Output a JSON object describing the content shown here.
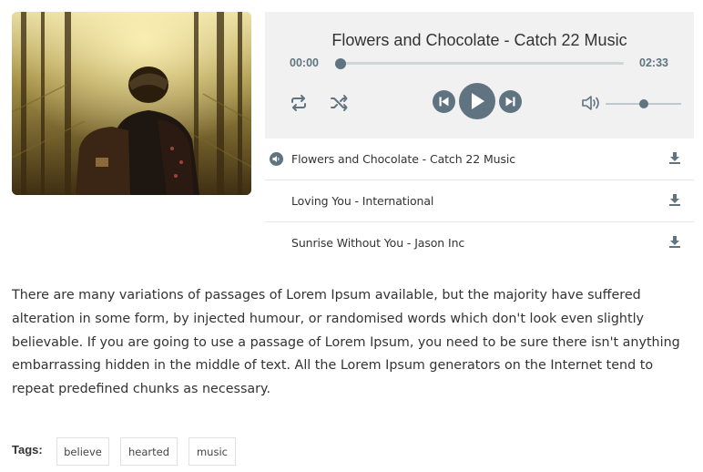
{
  "player": {
    "now_playing_title": "Flowers and Chocolate - Catch 22 Music",
    "current_time": "00:00",
    "duration": "02:33",
    "progress_fraction": 0.0,
    "volume_fraction": 0.5,
    "accent_color": "#5f7480"
  },
  "playlist": {
    "items": [
      {
        "label": "Flowers and Chocolate - Catch 22 Music",
        "playing": true
      },
      {
        "label": "Loving You - International",
        "playing": false
      },
      {
        "label": "Sunrise Without You - Jason Inc",
        "playing": false
      }
    ]
  },
  "description": "There are many variations of passages of Lorem Ipsum available, but the majority have suffered alteration in some form, by injected humour, or randomised words which don't look even slightly believable. If you are going to use a passage of Lorem Ipsum, you need to be sure there isn't anything embarrassing hidden in the middle of text. All the Lorem Ipsum generators on the Internet tend to repeat predefined chunks as necessary.",
  "tags": {
    "label": "Tags:",
    "items": [
      "believe",
      "hearted",
      "music"
    ]
  },
  "icons": {
    "repeat": "repeat-icon",
    "shuffle": "shuffle-icon",
    "prev": "skip-back-icon",
    "play": "play-icon",
    "next": "skip-forward-icon",
    "volume": "volume-icon",
    "download": "download-icon",
    "now_playing": "speaker-icon"
  }
}
